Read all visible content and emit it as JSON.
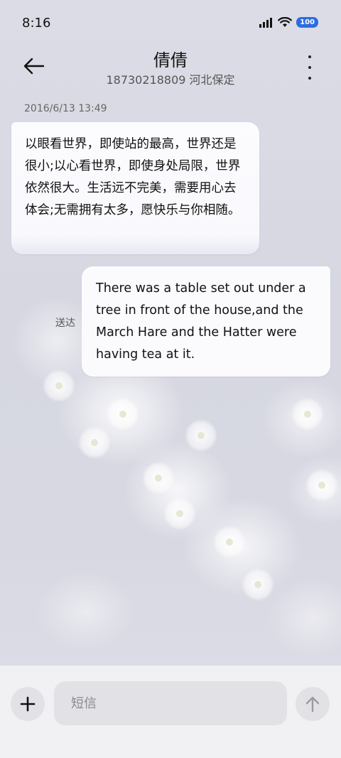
{
  "status_bar": {
    "time": "8:16",
    "battery": "100",
    "icons": [
      "signal-icon",
      "wifi-icon",
      "battery-icon"
    ]
  },
  "header": {
    "contact_name": "倩倩",
    "contact_detail": "18730218809 河北保定"
  },
  "messages": [
    {
      "timestamp": "2016/6/13 13:49",
      "direction": "incoming",
      "text": "以眼看世界，即使站的最高，世界还是很小;以心看世界，即使身处局限，世界依然很大。生活远不完美，需要用心去体会;无需拥有太多，愿快乐与你相随。"
    },
    {
      "direction": "outgoing",
      "status": "送达",
      "text": "There was a table set out under a tree in front of the house,and the March Hare and the Hatter were having tea at it."
    }
  ],
  "compose": {
    "placeholder": "短信"
  },
  "colors": {
    "background": "#dcdce6",
    "bubble": "#fcfcff",
    "battery_badge": "#2d6cdf",
    "compose_bar": "#f1f1f3"
  }
}
